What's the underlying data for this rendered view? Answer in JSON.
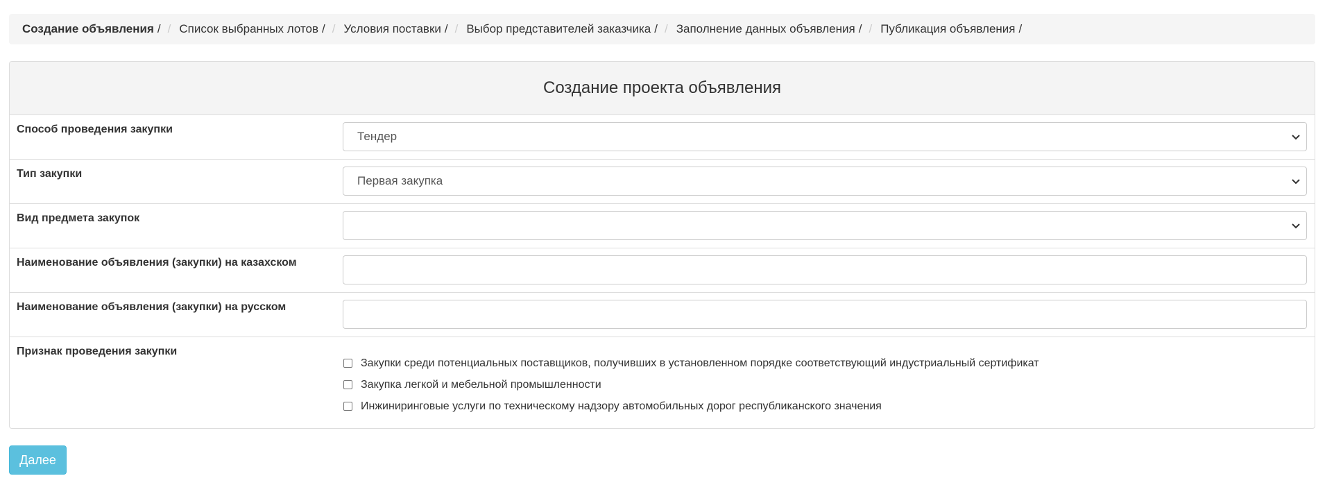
{
  "breadcrumb": {
    "items": [
      {
        "label": "Создание объявления"
      },
      {
        "label": "Список выбранных лотов"
      },
      {
        "label": "Условия поставки"
      },
      {
        "label": "Выбор представителей заказчика"
      },
      {
        "label": "Заполнение данных объявления"
      },
      {
        "label": "Публикация объявления"
      }
    ],
    "separator": "/"
  },
  "panel": {
    "title": "Создание проекта объявления",
    "fields": {
      "method": {
        "label": "Способ проведения закупки",
        "value": "Тендер"
      },
      "type": {
        "label": "Тип закупки",
        "value": "Первая закупка"
      },
      "subject": {
        "label": "Вид предмета закупок",
        "value": ""
      },
      "name_kz": {
        "label": "Наименование объявления (закупки) на казахском",
        "value": ""
      },
      "name_ru": {
        "label": "Наименование объявления (закупки) на русском",
        "value": ""
      }
    },
    "attributes": {
      "label": "Признак проведения закупки",
      "options": [
        {
          "label": "Закупки среди потенциальных поставщиков, получивших в установленном порядке соответствующий индустриальный сертификат",
          "checked": false
        },
        {
          "label": "Закупка легкой и мебельной промышленности",
          "checked": false
        },
        {
          "label": "Инжиниринговые услуги по техническому надзору автомобильных дорог республиканского значения",
          "checked": false
        }
      ]
    }
  },
  "actions": {
    "next_label": "Далее"
  },
  "colors": {
    "button": "#5bc0de",
    "panel_heading": "#f4f4f4",
    "breadcrumb_bg": "#f5f5f5"
  },
  "icons": {
    "select": "chevron-down-icon"
  }
}
